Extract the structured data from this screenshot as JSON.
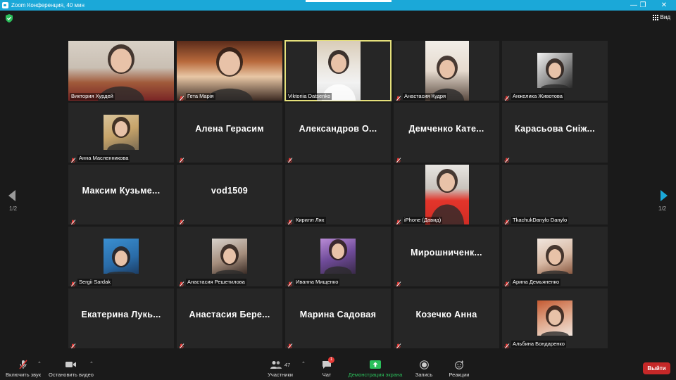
{
  "window": {
    "title": "Zoom Конференция, 40 мин",
    "minimize": "—",
    "maximize": "❐",
    "close": "✕"
  },
  "topbar": {
    "view_label": "Вид",
    "security_icon": "shield-check-icon"
  },
  "pagination": {
    "left": "1/2",
    "right": "1/2"
  },
  "tiles": [
    {
      "name": "Виктория  Хурдей",
      "type": "video",
      "muted": false
    },
    {
      "name": "Гета Марія",
      "type": "video",
      "muted": true
    },
    {
      "name": "Viktoriia Datsenko",
      "type": "video",
      "muted": false,
      "active": true
    },
    {
      "name": "Анастасия Кудря",
      "type": "video",
      "muted": true
    },
    {
      "name": "Анжелика Животова",
      "type": "photo",
      "muted": true
    },
    {
      "name": "Анна Масленникова",
      "type": "photo",
      "muted": true
    },
    {
      "display": "Алена Герасим",
      "type": "text",
      "muted": true
    },
    {
      "display": "Александров  О...",
      "type": "text",
      "muted": true
    },
    {
      "display": "Демченко  Кате...",
      "type": "text",
      "muted": true
    },
    {
      "display": "Карасьова  Сніж...",
      "type": "text",
      "muted": true
    },
    {
      "display": "Максим  Кузьме...",
      "type": "text",
      "muted": true
    },
    {
      "display": "vod1509",
      "type": "text",
      "muted": true
    },
    {
      "name": "Кирилл Лях",
      "type": "blank",
      "muted": true
    },
    {
      "name": "iPhone (Давид)",
      "type": "photo",
      "muted": true
    },
    {
      "name": "TkachukDanylo Danylo",
      "type": "blank",
      "muted": true
    },
    {
      "name": "Sergii Sardak",
      "type": "photo",
      "muted": true
    },
    {
      "name": "Анастасия Решетилова",
      "type": "photo",
      "muted": true
    },
    {
      "name": "Иванна Мищенко",
      "type": "photo",
      "muted": true
    },
    {
      "display": "Мирошниченк...",
      "type": "text",
      "muted": true
    },
    {
      "name": "Арина Демьяненко",
      "type": "photo",
      "muted": true
    },
    {
      "display": "Екатерина  Лукь...",
      "type": "text",
      "muted": true
    },
    {
      "display": "Анастасия  Бере...",
      "type": "text",
      "muted": true
    },
    {
      "display": "Марина Садовая",
      "type": "text",
      "muted": true
    },
    {
      "display": "Козечко Анна",
      "type": "text",
      "muted": true
    },
    {
      "name": "Альбина Бондаренко",
      "type": "photo",
      "muted": true
    }
  ],
  "toolbar": {
    "audio_label": "Включить звук",
    "video_label": "Остановить видео",
    "participants_label": "Участники",
    "participants_count": "47",
    "chat_label": "Чат",
    "chat_badge": "1",
    "share_label": "Демонстрация экрана",
    "record_label": "Запись",
    "reactions_label": "Реакции",
    "leave_label": "Выйти"
  },
  "colors": {
    "accent": "#1ba8d8",
    "active_speaker": "#e5e07b",
    "share_green": "#2bbf5b",
    "leave_red": "#c62828",
    "mute_red": "#e53935"
  }
}
